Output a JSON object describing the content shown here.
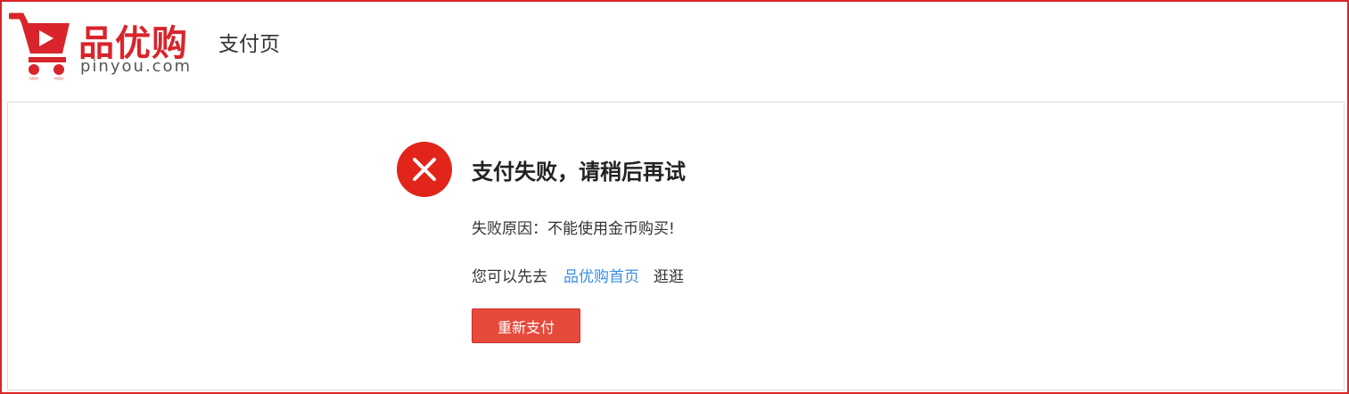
{
  "header": {
    "logo_cn": "品优购",
    "logo_en": "pinyou.com",
    "page_title": "支付页"
  },
  "result": {
    "status_icon": "close-icon",
    "title": "支付失败，请稍后再试",
    "reason": "失败原因：不能使用金币购买!",
    "suggest_prefix": "您可以先去",
    "home_link": "品优购首页",
    "suggest_suffix": "逛逛",
    "retry_label": "重新支付"
  },
  "colors": {
    "brand": "#d9242b",
    "fail": "#e1251b",
    "link": "#3a8ee6",
    "button": "#e64a3b"
  }
}
